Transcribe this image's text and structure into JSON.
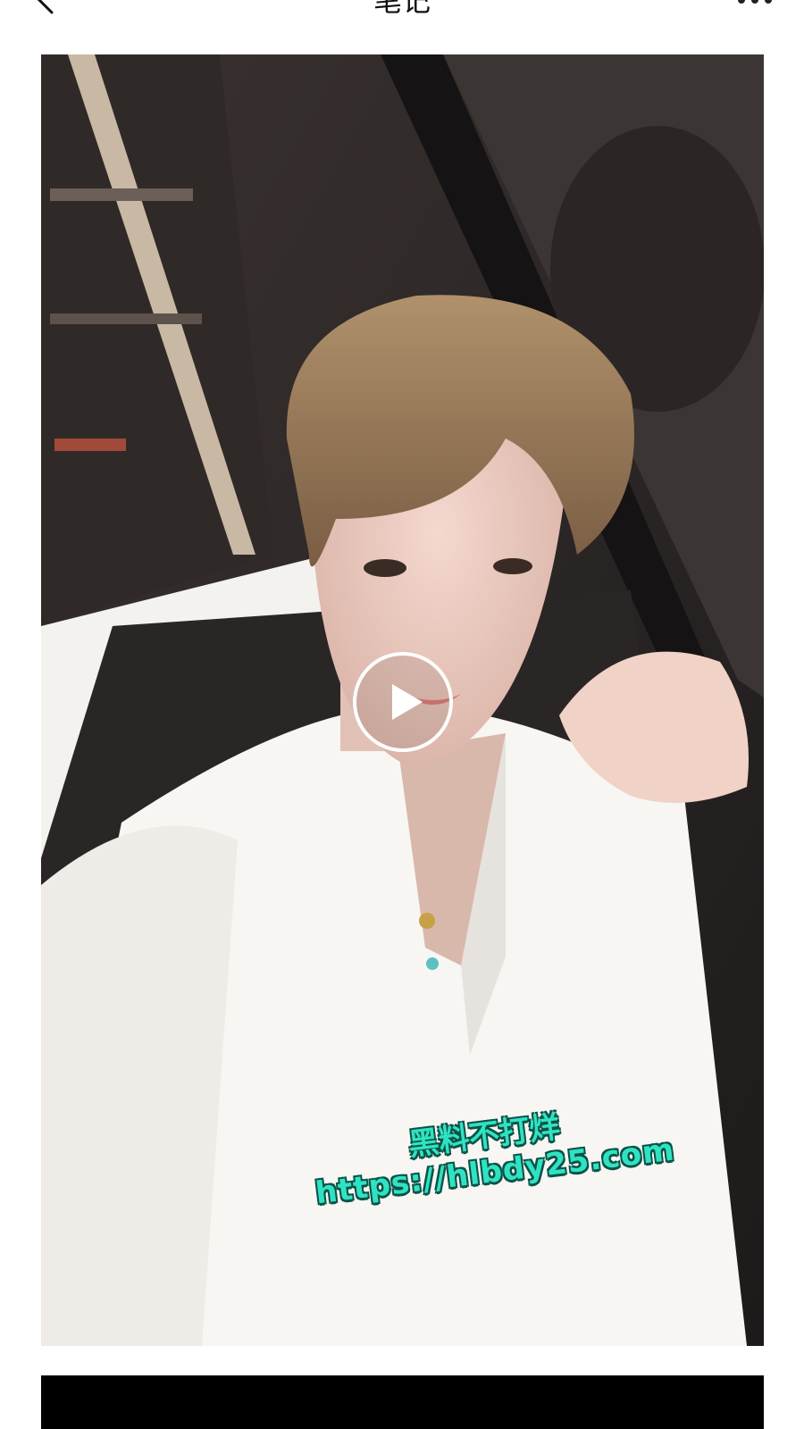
{
  "header": {
    "title": "笔记",
    "back_icon": "chevron-left-icon",
    "more_icon": "more-dots-icon"
  },
  "media": {
    "type": "video",
    "play_icon": "play-icon",
    "watermark_line1": "黑料不打烊",
    "watermark_line2": "https://hlbdy25.com",
    "watermark_color": "#2fe3c2"
  },
  "next_media": {
    "background": "#000000"
  }
}
